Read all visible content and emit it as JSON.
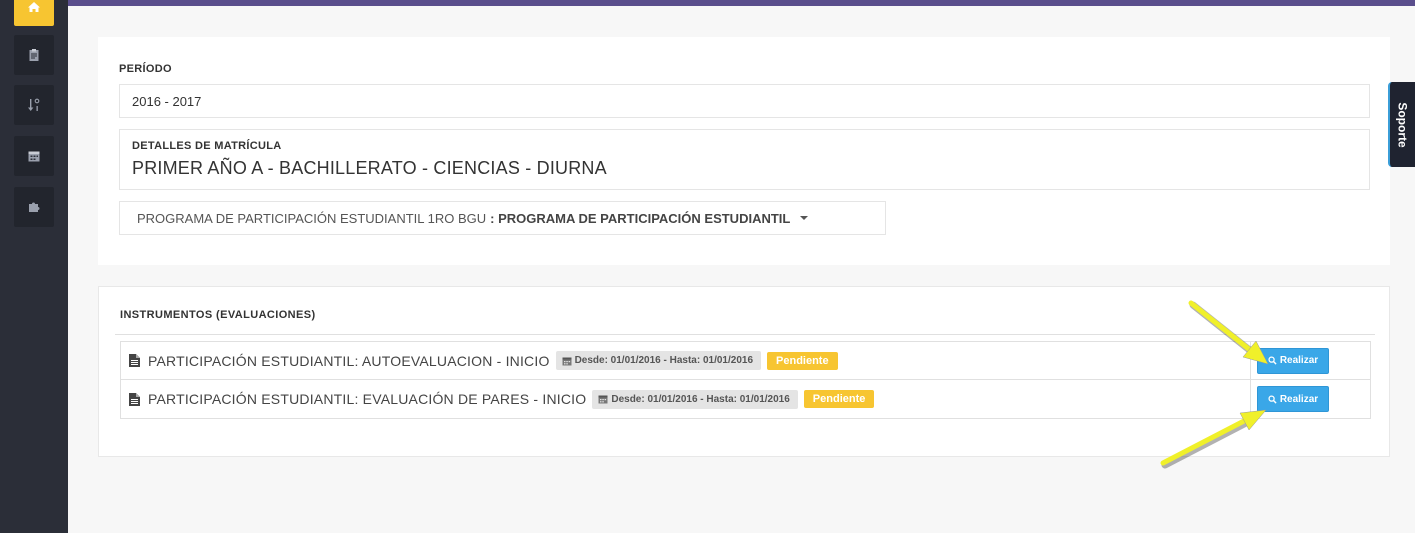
{
  "sidebar": {
    "items": [
      {
        "icon": "home-icon"
      },
      {
        "icon": "clipboard-icon"
      },
      {
        "icon": "sort-numeric-icon"
      },
      {
        "icon": "calendar-icon"
      },
      {
        "icon": "puzzle-icon"
      }
    ]
  },
  "periodo": {
    "label": "PERÍODO",
    "value": "2016 - 2017"
  },
  "matricula": {
    "label": "DETALLES DE MATRÍCULA",
    "value": "PRIMER AÑO A - BACHILLERATO - CIENCIAS - DIURNA"
  },
  "programa": {
    "prefix": "PROGRAMA DE PARTICIPACIÓN ESTUDIANTIL 1RO BGU",
    "selected": ": PROGRAMA DE PARTICIPACIÓN ESTUDIANTIL"
  },
  "instrumentos": {
    "title": "INSTRUMENTOS (EVALUACIONES)",
    "rows": [
      {
        "title": "PARTICIPACIÓN ESTUDIANTIL: AUTOEVALUACION - INICIO",
        "dates": "Desde: 01/01/2016 - Hasta: 01/01/2016",
        "status": "Pendiente",
        "action": "Realizar"
      },
      {
        "title": "PARTICIPACIÓN ESTUDIANTIL: EVALUACIÓN DE PARES - INICIO",
        "dates": "Desde: 01/01/2016 - Hasta: 01/01/2016",
        "status": "Pendiente",
        "action": "Realizar"
      }
    ]
  },
  "soporte": {
    "label": "Soporte"
  },
  "colors": {
    "accent_yellow": "#f7c531",
    "primary_blue": "#3aa7e8",
    "topbar_purple": "#5a4e8c",
    "sidebar": "#2b2e38"
  }
}
